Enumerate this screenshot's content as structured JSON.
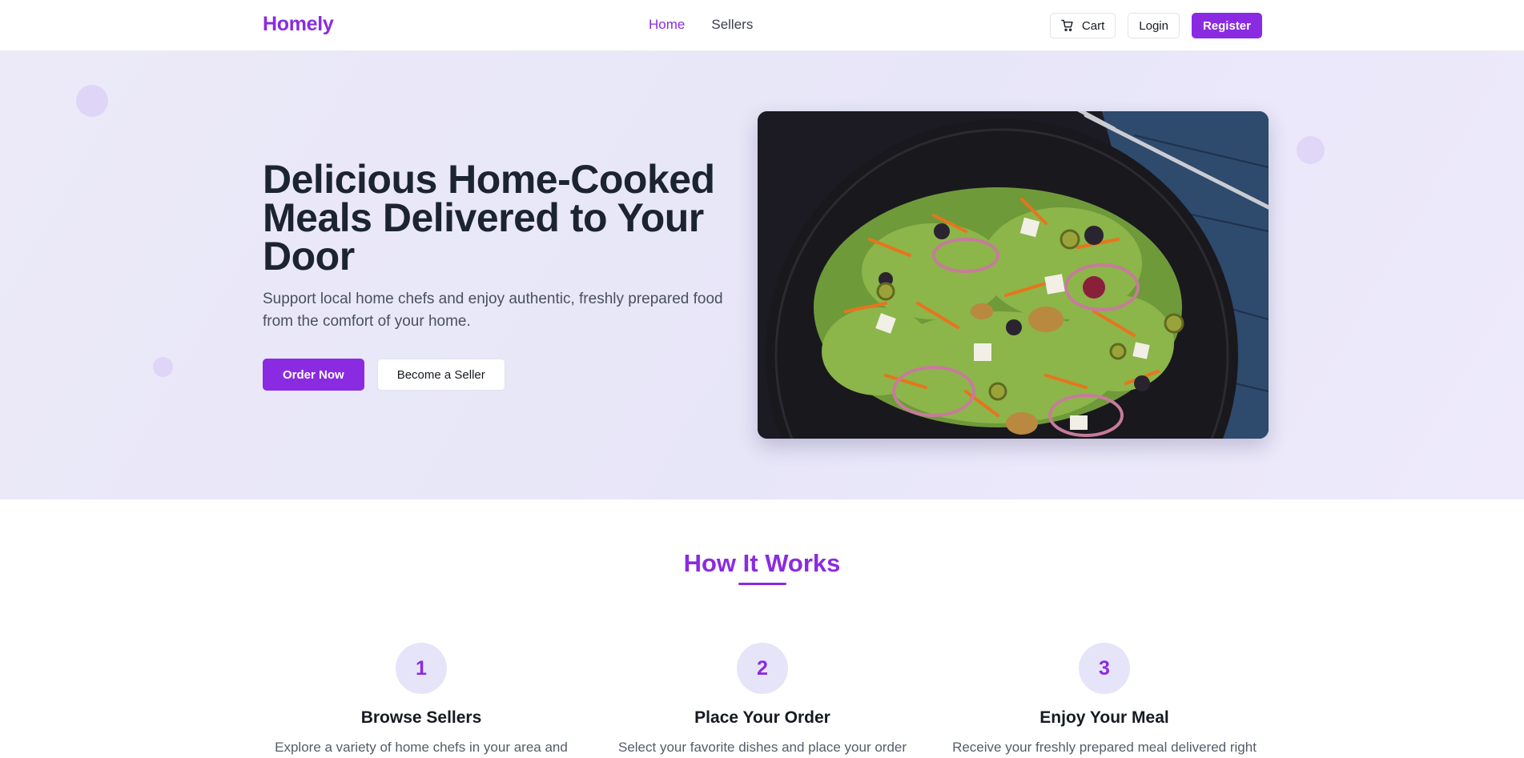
{
  "navbar": {
    "brand": "Homely",
    "links": [
      {
        "label": "Home",
        "active": true
      },
      {
        "label": "Sellers",
        "active": false
      }
    ],
    "cart_label": "Cart",
    "login_label": "Login",
    "register_label": "Register"
  },
  "hero": {
    "title": "Delicious Home-Cooked Meals Delivered to Your Door",
    "subtitle": "Support local home chefs and enjoy authentic, freshly prepared food from the comfort of your home.",
    "primary_cta": "Order Now",
    "secondary_cta": "Become a Seller"
  },
  "how_it_works": {
    "title": "How It Works",
    "steps": [
      {
        "number": "1",
        "title": "Browse Sellers",
        "description": "Explore a variety of home chefs in your area and"
      },
      {
        "number": "2",
        "title": "Place Your Order",
        "description": "Select your favorite dishes and place your order"
      },
      {
        "number": "3",
        "title": "Enjoy Your Meal",
        "description": "Receive your freshly prepared meal delivered right"
      }
    ]
  },
  "colors": {
    "brand": "#8a2be2",
    "hero_background": "#e8e7f8",
    "step_circle": "#e6e4f9"
  },
  "icons": {
    "cart": "shopping-cart-icon"
  }
}
